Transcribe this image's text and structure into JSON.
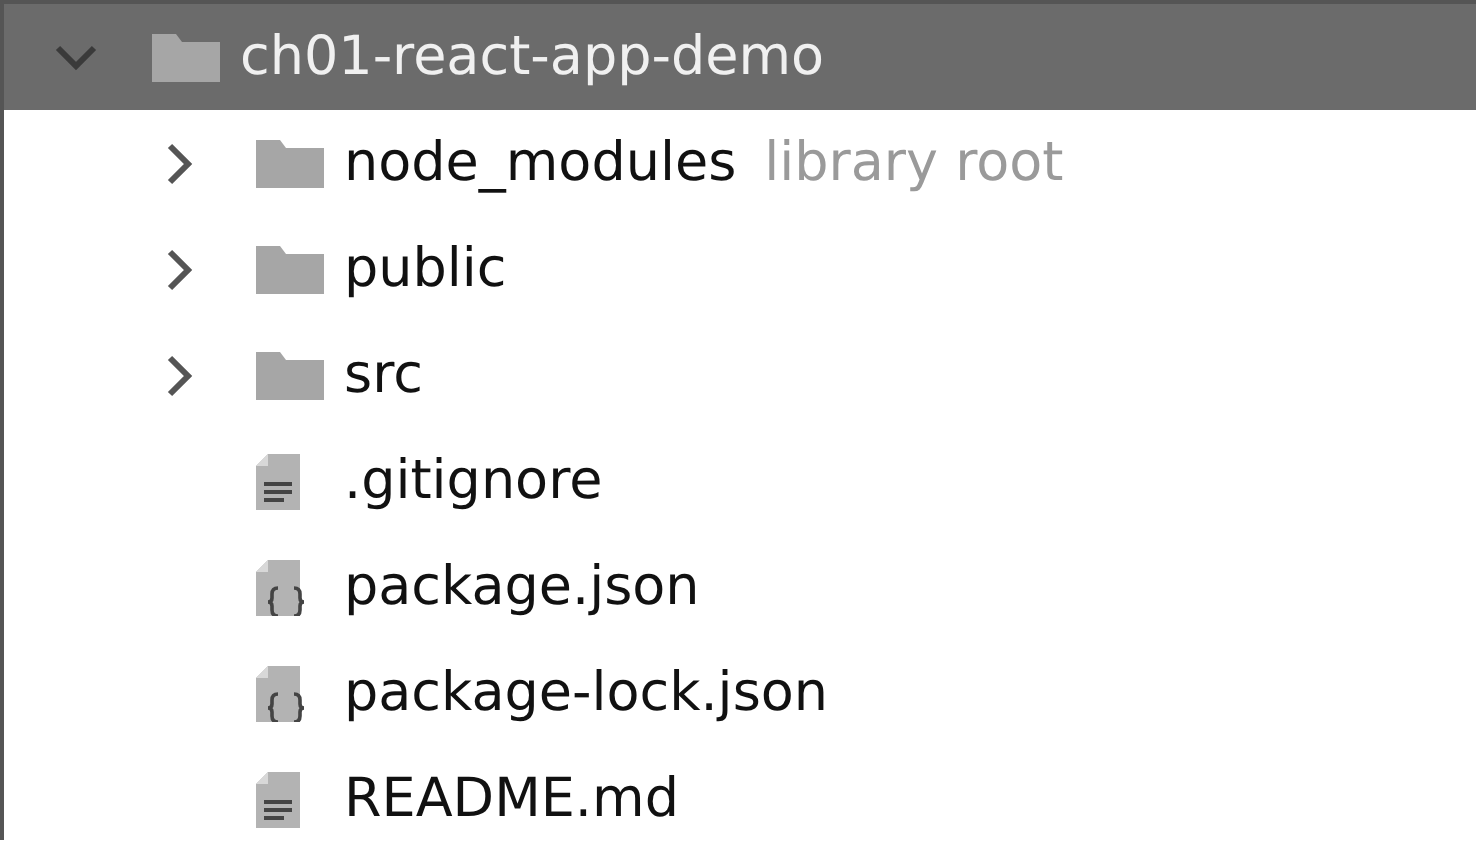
{
  "tree": [
    {
      "label": "ch01-react-app-demo",
      "kind": "folder",
      "expanded": true,
      "selected": true,
      "children": [
        {
          "label": "node_modules",
          "kind": "folder",
          "expanded": false,
          "selected": false,
          "note": "library root"
        },
        {
          "label": "public",
          "kind": "folder",
          "expanded": false,
          "selected": false
        },
        {
          "label": "src",
          "kind": "folder",
          "expanded": false,
          "selected": false
        },
        {
          "label": ".gitignore",
          "kind": "text-file",
          "selected": false
        },
        {
          "label": "package.json",
          "kind": "json-file",
          "selected": false
        },
        {
          "label": "package-lock.json",
          "kind": "json-file",
          "selected": false
        },
        {
          "label": "README.md",
          "kind": "text-file",
          "selected": false
        }
      ]
    }
  ]
}
